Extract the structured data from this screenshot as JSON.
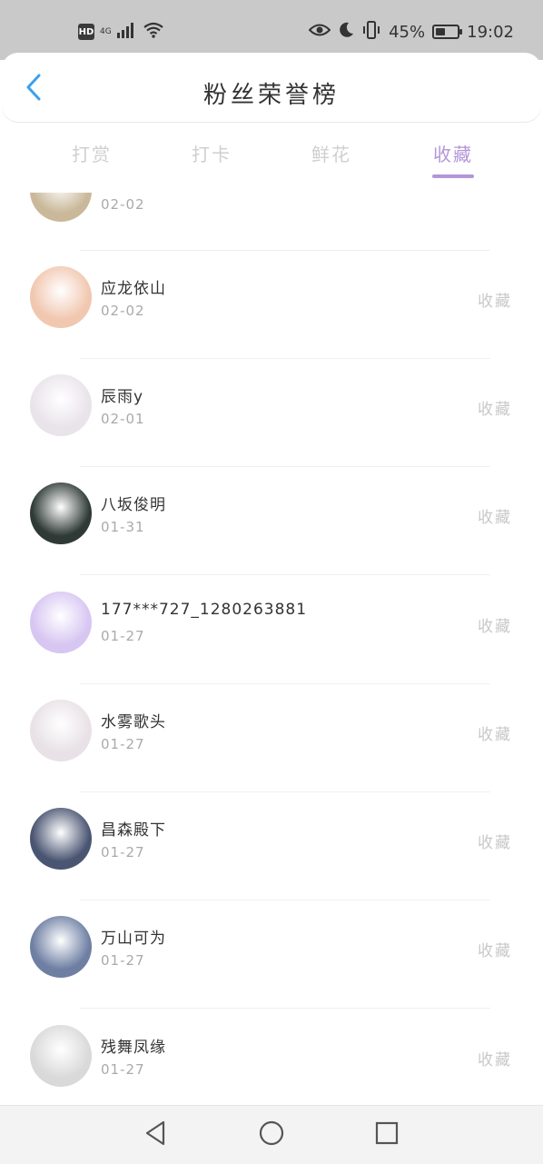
{
  "status_bar": {
    "hd": "HD",
    "network": "4G",
    "signal": "signal-icon",
    "battery_percent": "45%",
    "battery_level": 0.45,
    "time": "19:02"
  },
  "header": {
    "title": "粉丝荣誉榜",
    "back_icon": "chevron-left-icon"
  },
  "tabs": [
    {
      "label": "打赏",
      "active": false
    },
    {
      "label": "打卡",
      "active": false
    },
    {
      "label": "鲜花",
      "active": false
    },
    {
      "label": "收藏",
      "active": true
    }
  ],
  "list": [
    {
      "name": "",
      "date": "02-02",
      "action": "",
      "avatar_color": "#c9b89a"
    },
    {
      "name": "应龙依山",
      "date": "02-02",
      "action": "收藏",
      "avatar_color": "#f1c7b0"
    },
    {
      "name": "辰雨y",
      "date": "02-01",
      "action": "收藏",
      "avatar_color": "#e9e3ea"
    },
    {
      "name": "八坂俊明",
      "date": "01-31",
      "action": "收藏",
      "avatar_color": "#2f3a36"
    },
    {
      "name": "177***727_1280263881",
      "date": "01-27",
      "action": "收藏",
      "avatar_color": "#d7c6f2"
    },
    {
      "name": "水雾歌头",
      "date": "01-27",
      "action": "收藏",
      "avatar_color": "#e8e1e6"
    },
    {
      "name": "昌森殿下",
      "date": "01-27",
      "action": "收藏",
      "avatar_color": "#4a5572"
    },
    {
      "name": "万山可为",
      "date": "01-27",
      "action": "收藏",
      "avatar_color": "#6e7fa3"
    },
    {
      "name": "残舞凤缘",
      "date": "01-27",
      "action": "收藏",
      "avatar_color": "#d9d9d9"
    }
  ],
  "nav": {
    "back": "triangle-back-icon",
    "home": "circle-home-icon",
    "recent": "square-recent-icon"
  },
  "colors": {
    "accent": "#b495d8",
    "back_arrow": "#3aa0f0",
    "status_bar_bg": "#c9c9c9"
  }
}
